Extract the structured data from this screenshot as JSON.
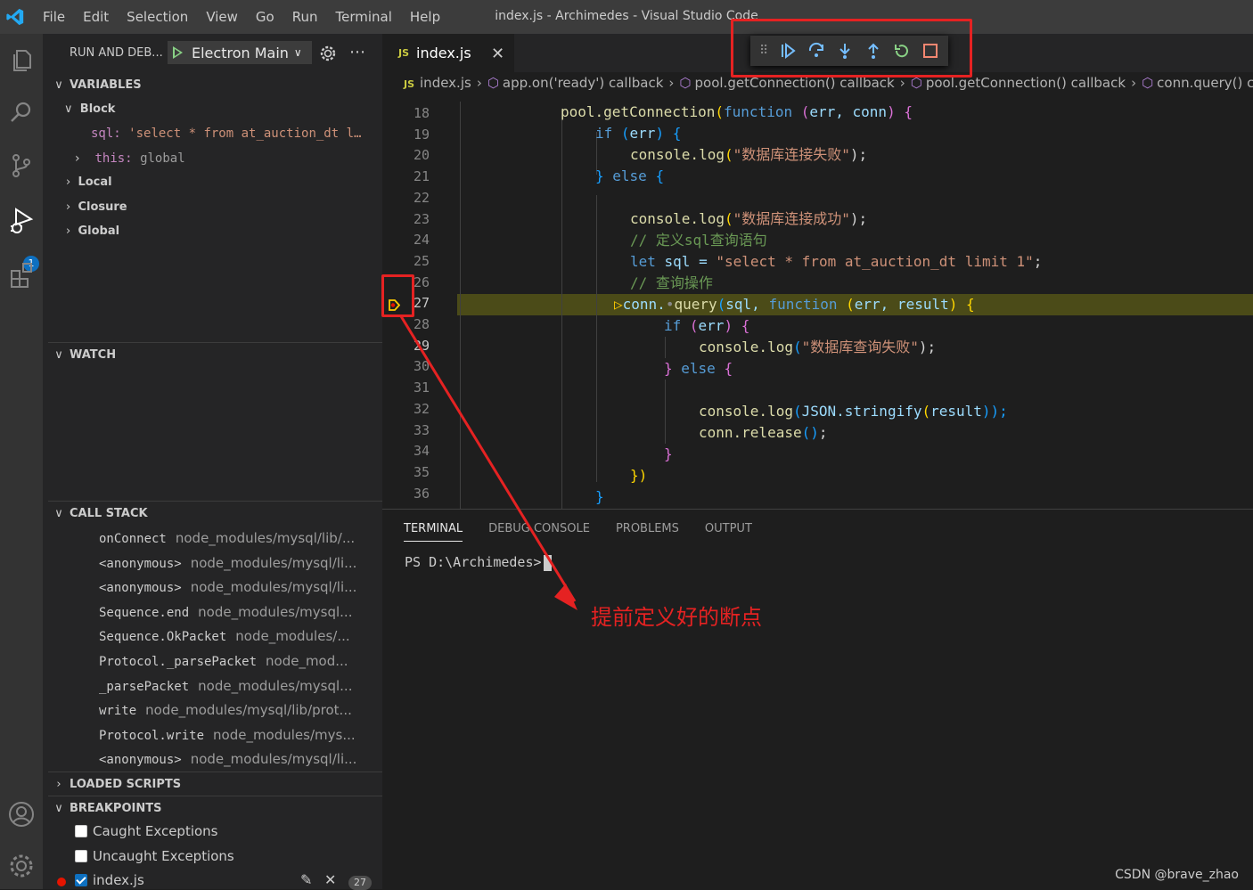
{
  "menu": [
    "File",
    "Edit",
    "Selection",
    "View",
    "Go",
    "Run",
    "Terminal",
    "Help"
  ],
  "window_title": "index.js - Archimedes - Visual Studio Code",
  "activity_badge": "1",
  "sidebar": {
    "title": "RUN AND DEB...",
    "config": "Electron Main",
    "variables": {
      "header": "VARIABLES",
      "block": "Block",
      "sql_name": "sql:",
      "sql_value": "'select * from at_auction_dt l…",
      "this_name": "this:",
      "this_value": "global",
      "local": "Local",
      "closure": "Closure",
      "global": "Global"
    },
    "watch": "WATCH",
    "call_stack": {
      "header": "CALL STACK",
      "frames": [
        {
          "fn": "onConnect",
          "src": "node_modules/mysql/lib/..."
        },
        {
          "fn": "<anonymous>",
          "src": "node_modules/mysql/li..."
        },
        {
          "fn": "<anonymous>",
          "src": "node_modules/mysql/li..."
        },
        {
          "fn": "Sequence.end",
          "src": "node_modules/mysql..."
        },
        {
          "fn": "Sequence.OkPacket",
          "src": "node_modules/..."
        },
        {
          "fn": "Protocol._parsePacket",
          "src": "node_mod..."
        },
        {
          "fn": "_parsePacket",
          "src": "node_modules/mysql..."
        },
        {
          "fn": "write",
          "src": "node_modules/mysql/lib/prot..."
        },
        {
          "fn": "Protocol.write",
          "src": "node_modules/mys..."
        },
        {
          "fn": "<anonymous>",
          "src": "node_modules/mysql/li..."
        }
      ]
    },
    "loaded_scripts": "LOADED SCRIPTS",
    "breakpoints": {
      "header": "BREAKPOINTS",
      "caught": "Caught Exceptions",
      "uncaught": "Uncaught Exceptions",
      "file": "index.js",
      "line": "27"
    }
  },
  "editor": {
    "tab": "index.js",
    "breadcrumb": [
      "index.js",
      "app.on('ready') callback",
      "pool.getConnection() callback",
      "pool.getConnection() callback",
      "conn.query() ca"
    ],
    "line_numbers": [
      "18",
      "19",
      "20",
      "21",
      "22",
      "23",
      "24",
      "25",
      "26",
      "27",
      "28",
      "29",
      "30",
      "31",
      "32",
      "33",
      "34",
      "35",
      "36"
    ]
  },
  "code": {
    "l18": [
      "pool.getConnection",
      "(",
      "function",
      " (",
      "err, conn",
      ") ",
      "{"
    ],
    "l19": [
      "if",
      " (",
      "err",
      ") ",
      "{"
    ],
    "l20": [
      "console.log",
      "(",
      "\"数据库连接失败\"",
      ");"
    ],
    "l21": [
      "}",
      " else ",
      "{"
    ],
    "l23": [
      "console.log",
      "(",
      "\"数据库连接成功\"",
      ");"
    ],
    "l24": "// 定义sql查询语句",
    "l25": [
      "let",
      " sql = ",
      "\"select * from at_auction_dt limit 1\"",
      ";"
    ],
    "l26": "// 查询操作",
    "l27": [
      "conn.",
      "query",
      "(",
      "sql, ",
      "function",
      " (",
      "err, result",
      ") ",
      "{"
    ],
    "l28": [
      "if",
      " (",
      "err",
      ") ",
      "{"
    ],
    "l29": [
      "console.log",
      "(",
      "\"数据库查询失败\"",
      ");"
    ],
    "l30": [
      "}",
      " else ",
      "{"
    ],
    "l32": [
      "console.log",
      "(",
      "JSON.stringify",
      "(",
      "result",
      "));"
    ],
    "l33": [
      "conn.release",
      "()",
      ";"
    ],
    "l34": "}",
    "l35": "})",
    "l36": "}"
  },
  "panel": {
    "tabs": [
      "TERMINAL",
      "DEBUG CONSOLE",
      "PROBLEMS",
      "OUTPUT"
    ],
    "prompt": "PS D:\\Archimedes>"
  },
  "annotation": "提前定义好的断点",
  "watermark": "CSDN @brave_zhao"
}
